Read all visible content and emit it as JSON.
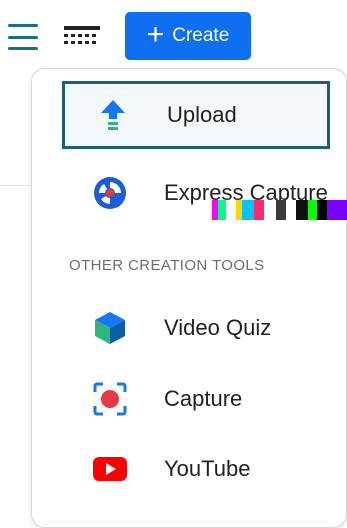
{
  "toolbar": {
    "menu_icon": "hamburger-menu-icon",
    "grid_icon": "grid-view-icon",
    "create_label": "Create",
    "create_icon": "plus-icon",
    "create_color": "#0e6ff0"
  },
  "dropdown": {
    "items": [
      {
        "label": "Upload",
        "icon": "upload-arrow-icon",
        "selected": true
      },
      {
        "label": "Express Capture",
        "icon": "express-capture-icon",
        "selected": false
      }
    ],
    "section_header": "OTHER CREATION TOOLS",
    "other_items": [
      {
        "label": "Video Quiz",
        "icon": "cube-icon"
      },
      {
        "label": "Capture",
        "icon": "capture-record-icon"
      },
      {
        "label": "YouTube",
        "icon": "youtube-icon"
      }
    ]
  },
  "colors": {
    "accent": "#0e6ff0",
    "selection_border": "#1c5f76",
    "menu_icon": "#1a6f86"
  }
}
